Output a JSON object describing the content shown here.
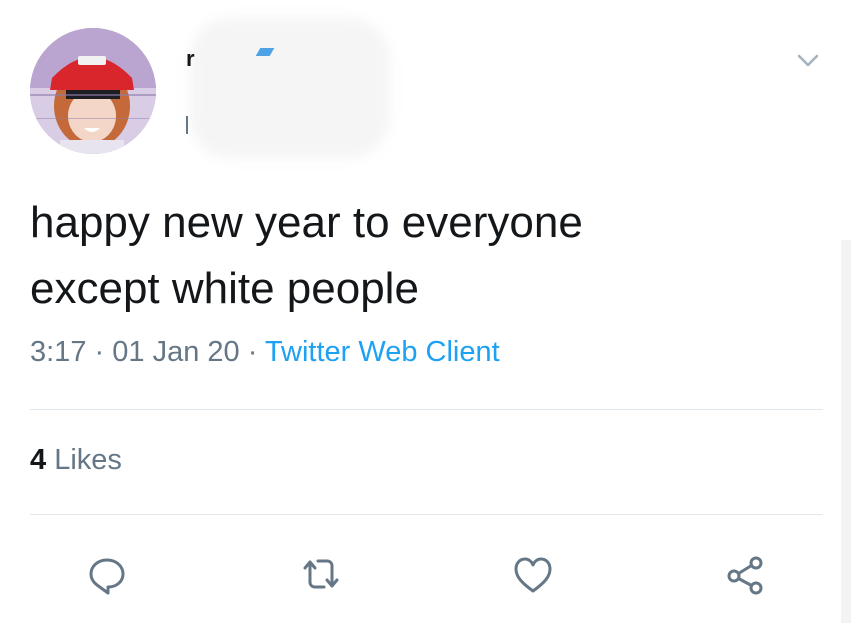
{
  "tweet": {
    "author_name_fragment": "r",
    "text_line_1": "happy new year to everyone",
    "text_line_2": "except white people",
    "time": "3:17",
    "separator": "·",
    "date": "01 Jan 20",
    "source": "Twitter Web Client"
  },
  "stats": {
    "likes_count": "4",
    "likes_label": "Likes"
  },
  "actions": [
    {
      "name": "reply",
      "icon": "reply-icon"
    },
    {
      "name": "retweet",
      "icon": "retweet-icon"
    },
    {
      "name": "like",
      "icon": "heart-icon"
    },
    {
      "name": "share",
      "icon": "share-icon"
    }
  ],
  "colors": {
    "text": "#14171a",
    "secondary": "#657786",
    "link": "#1da1f2",
    "divider": "#e1e8ed",
    "icon": "#657786"
  }
}
